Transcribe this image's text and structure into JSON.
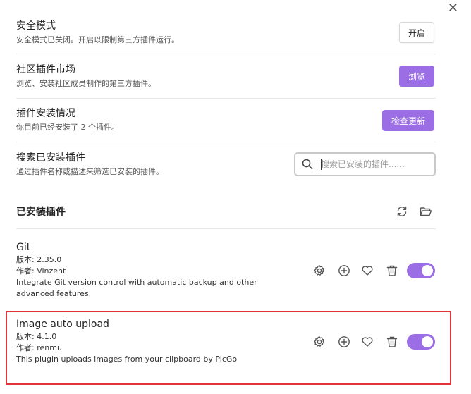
{
  "window": {
    "close_glyph": "✕"
  },
  "settings": {
    "safe_mode": {
      "title": "安全模式",
      "desc": "安全模式已关闭。开启以限制第三方插件运行。",
      "button": "开启"
    },
    "community": {
      "title": "社区插件市场",
      "desc": "浏览、安装社区成员制作的第三方插件。",
      "button": "浏览"
    },
    "installed_info": {
      "title": "插件安装情况",
      "desc": "你目前已经安装了 2 个插件。",
      "button": "检查更新"
    },
    "search": {
      "title": "搜索已安装插件",
      "desc": "通过插件名称或描述来筛选已安装的插件。",
      "placeholder": "搜索已安装的插件......"
    }
  },
  "installed_section": {
    "title": "已安装插件",
    "icons": [
      "refresh-icon",
      "folder-open-icon"
    ]
  },
  "plugins": [
    {
      "name": "Git",
      "version": "版本: 2.35.0",
      "author": "作者: Vinzent",
      "desc": "Integrate Git version control with automatic backup and other advanced features.",
      "enabled": true
    },
    {
      "name": "Image auto upload",
      "version": "版本: 4.1.0",
      "author": "作者: renmu",
      "desc": "This plugin uploads images from your clipboard by PicGo",
      "enabled": true
    }
  ],
  "colors": {
    "accent": "#9c6ee6",
    "highlight": "#e0343a",
    "divider": "#e6e6e6"
  }
}
